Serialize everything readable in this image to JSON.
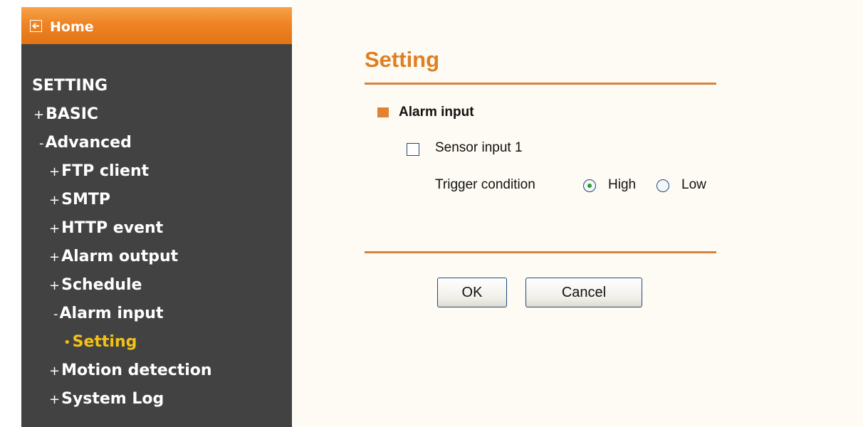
{
  "sidebar": {
    "home_label": "Home",
    "items": [
      {
        "prefix": "",
        "label": "SETTING"
      },
      {
        "prefix": "+",
        "label": "BASIC"
      },
      {
        "prefix": "-",
        "label": "Advanced"
      },
      {
        "prefix": "+",
        "label": "FTP client"
      },
      {
        "prefix": "+",
        "label": "SMTP"
      },
      {
        "prefix": "+",
        "label": "HTTP event"
      },
      {
        "prefix": "+",
        "label": "Alarm output"
      },
      {
        "prefix": "+",
        "label": "Schedule"
      },
      {
        "prefix": "-",
        "label": "Alarm input"
      },
      {
        "prefix": "•",
        "label": "Setting"
      },
      {
        "prefix": "+",
        "label": "Motion detection"
      },
      {
        "prefix": "+",
        "label": "System Log"
      }
    ]
  },
  "main": {
    "title": "Setting",
    "section_title": "Alarm input",
    "sensor_label": "Sensor input 1",
    "sensor_checked": false,
    "trigger_label": "Trigger condition",
    "trigger_options": [
      {
        "label": "High",
        "selected": true
      },
      {
        "label": "Low",
        "selected": false
      }
    ],
    "ok_label": "OK",
    "cancel_label": "Cancel"
  },
  "colors": {
    "accent": "#e07e22",
    "sidebar_bg": "#424242",
    "active_nav": "#f3c217"
  }
}
